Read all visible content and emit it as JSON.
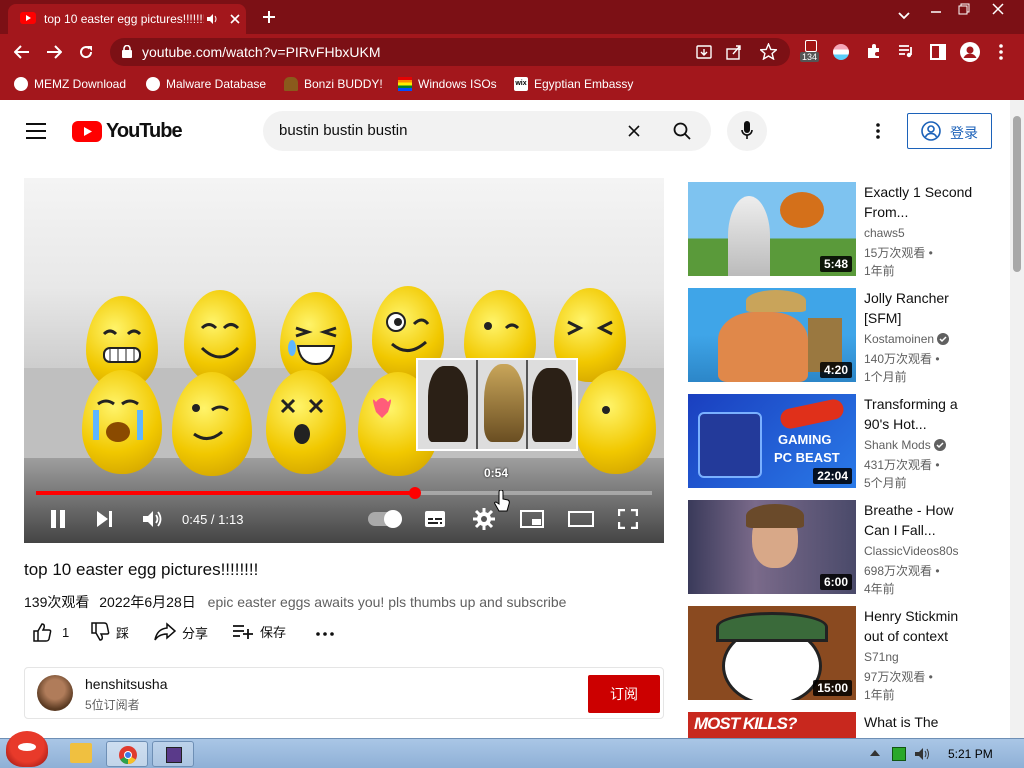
{
  "browser": {
    "tab_title": "top 10 easter egg pictures!!!!!!!!",
    "url": "youtube.com/watch?v=PIRvFHbxUKM",
    "extension_badge": "134",
    "bookmarks": [
      "MEMZ Download",
      "Malware Database",
      "Bonzi BUDDY!",
      "Windows ISOs",
      "Egyptian Embassy"
    ]
  },
  "yt": {
    "logo": "YouTube",
    "search_value": "bustin bustin bustin",
    "signin": "登录"
  },
  "player": {
    "hover_time": "0:54",
    "time_display": "0:45 / 1:13",
    "progress": 0.616
  },
  "video": {
    "title": "top 10 easter egg pictures!!!!!!!!",
    "views": "139次观看",
    "date": "2022年6月28日",
    "description": "epic easter eggs awaits you! pls thumbs up and subscribe",
    "likes": "1",
    "dislike_label": "踩",
    "share_label": "分享",
    "save_label": "保存"
  },
  "channel": {
    "name": "henshitsusha",
    "subscribers": "5位订阅者",
    "subscribe_label": "订阅"
  },
  "recommendations": [
    {
      "title": "Exactly 1 Second From...",
      "channel": "chaws5",
      "views": "15万次观看 •",
      "ago": "1年前",
      "duration": "5:48",
      "verified": false
    },
    {
      "title": "Jolly Rancher [SFM]",
      "channel": "Kostamoinen",
      "views": "140万次观看 •",
      "ago": "1个月前",
      "duration": "4:20",
      "verified": true
    },
    {
      "title": "Transforming a 90's Hot...",
      "channel": "Shank Mods",
      "views": "431万次观看 •",
      "ago": "5个月前",
      "duration": "22:04",
      "verified": true,
      "thumb_text": [
        "GAMING",
        "PC BEAST"
      ]
    },
    {
      "title": "Breathe - How Can I Fall...",
      "channel": "ClassicVideos80s",
      "views": "698万次观看 •",
      "ago": "4年前",
      "duration": "6:00",
      "verified": false
    },
    {
      "title": "Henry Stickmin out of context",
      "channel": "S71ng",
      "views": "97万次观看 •",
      "ago": "1年前",
      "duration": "15:00",
      "verified": false
    },
    {
      "title": "What is The",
      "thumb_text": "MOST KILLS?"
    }
  ],
  "taskbar": {
    "clock": "5:21 PM"
  },
  "colors": {
    "chrome_dark": "#7c1015",
    "chrome": "#a3171c",
    "yt_red": "#ff0000",
    "subscribe_red": "#cc0000",
    "link_blue": "#1c62b9"
  }
}
